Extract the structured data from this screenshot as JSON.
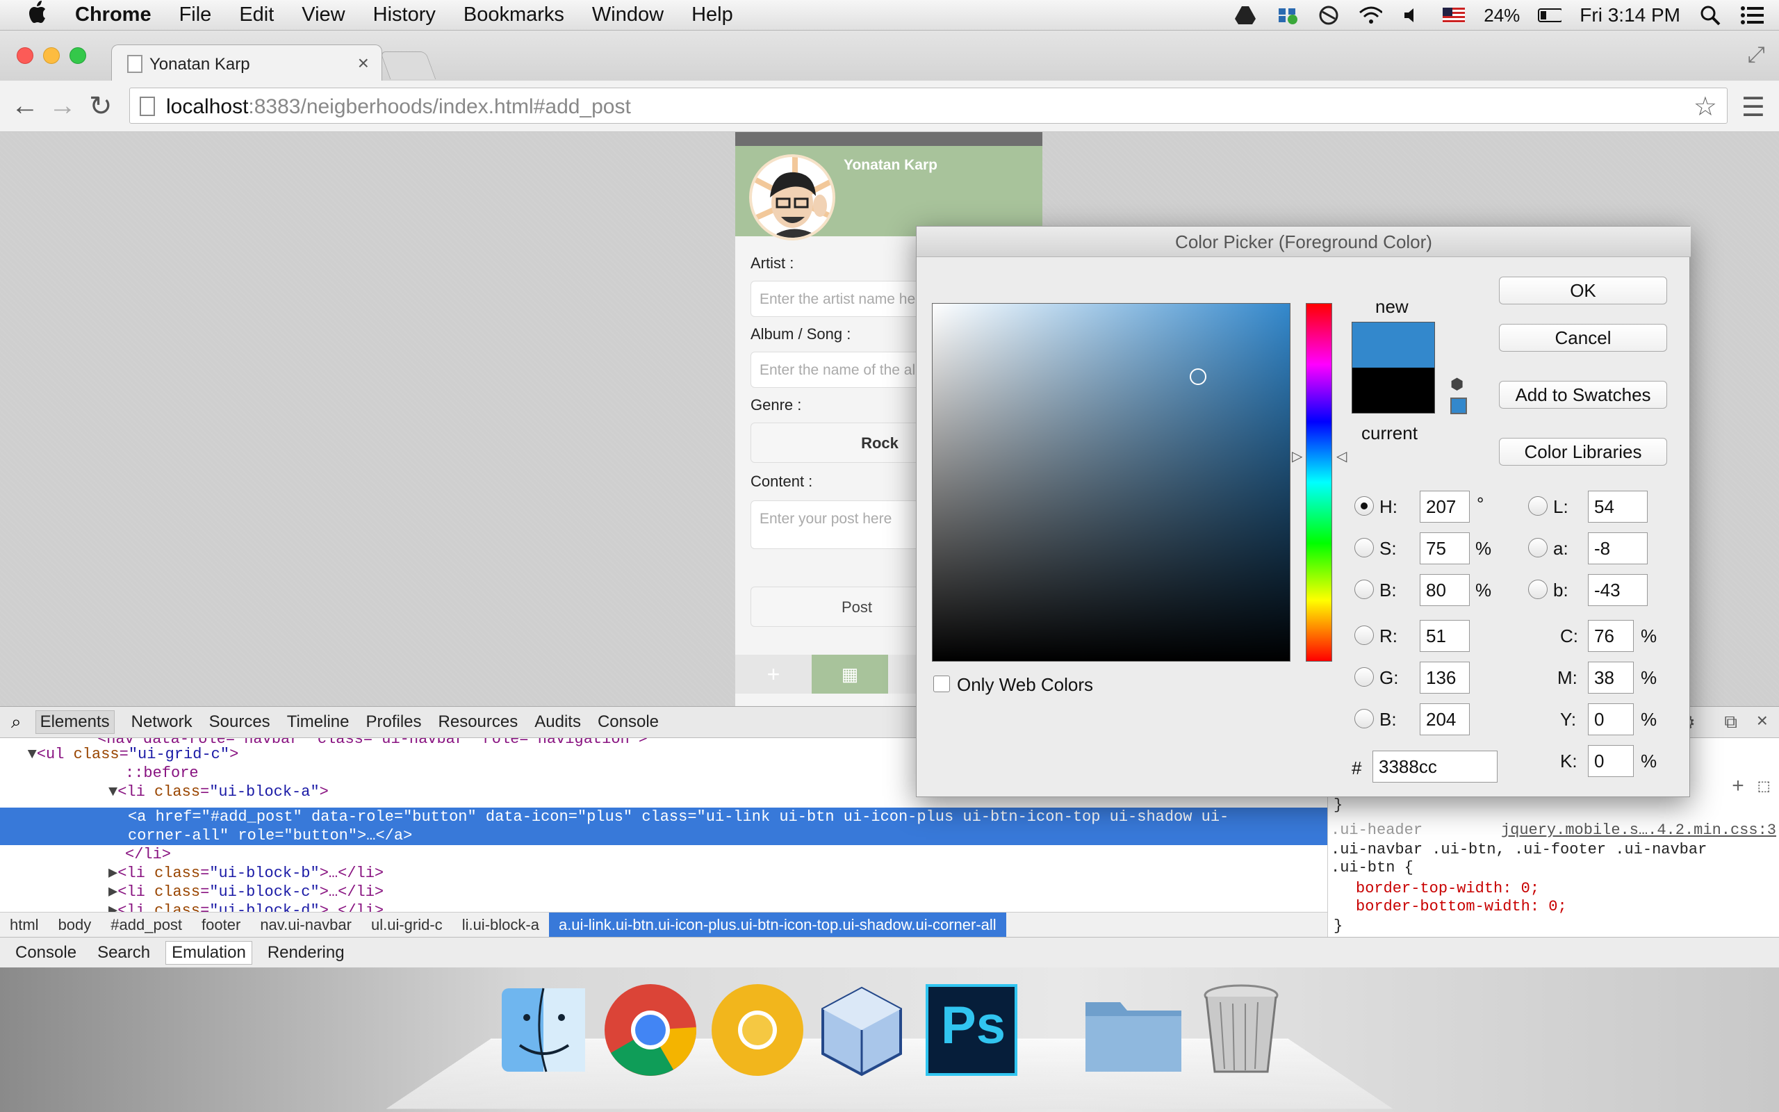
{
  "menubar": {
    "app_name": "Chrome",
    "items": [
      "File",
      "Edit",
      "View",
      "History",
      "Bookmarks",
      "Window",
      "Help"
    ],
    "battery": "24%",
    "clock": "Fri 3:14 PM"
  },
  "browser": {
    "tab_title": "Yonatan Karp",
    "url_host": "localhost",
    "url_rest": ":8383/neigberhoods/index.html#add_post"
  },
  "page": {
    "user_name": "Yonatan Karp",
    "artist_label": "Artist :",
    "artist_placeholder": "Enter the artist name here",
    "album_label": "Album / Song :",
    "album_placeholder": "Enter the name of the album",
    "genre_label": "Genre :",
    "genre_value": "Rock",
    "content_label": "Content :",
    "content_placeholder": "Enter your post here",
    "post_button": "Post"
  },
  "devtools": {
    "tabs": [
      "Elements",
      "Network",
      "Sources",
      "Timeline",
      "Profiles",
      "Resources",
      "Audits",
      "Console"
    ],
    "active_tab": "Elements",
    "breadcrumbs": [
      "html",
      "body",
      "#add_post",
      "footer",
      "nav.ui-navbar",
      "ul.ui-grid-c",
      "li.ui-block-a",
      "a.ui-link.ui-btn.ui-icon-plus.ui-btn-icon-top.ui-shadow.ui-corner-all"
    ],
    "drawer_tabs": [
      "Console",
      "Search",
      "Emulation",
      "Rendering"
    ],
    "drawer_active": "Emulation",
    "code": {
      "l0": "<nav data-role=\"navbar\" class=\"ui-navbar\" role=\"navigation\">",
      "l1_tag": "<ul ",
      "l1_attr": "class",
      "l1_val": "\"ui-grid-c\"",
      "l2": "::before",
      "l3_tag": "<li ",
      "l3_attr": "class",
      "l3_val": "\"ui-block-a\"",
      "sel1": "<a href=\"#add_post\" data-role=\"button\" data-icon=\"plus\" class=\"ui-link ui-btn ui-icon-plus ui-btn-icon-top ui-shadow ui-",
      "sel2": "corner-all\" role=\"button\">…</a>",
      "l5": "</li>",
      "l6_val": "\"ui-block-b\"",
      "l7_val": "\"ui-block-c\"",
      "l8_val": "\"ui-block-d\"",
      "li_close": ">…</li>"
    },
    "styles": {
      "brace": "}",
      "selector1": ".ui-header",
      "source": "jquery.mobile.s….4.2.min.css:3",
      "selector2": ".ui-navbar .ui-btn, .ui-footer .ui-navbar",
      "selector3": ".ui-btn {",
      "prop1": "border-top-width: 0;",
      "prop2": "border-bottom-width: 0;",
      "close": "}"
    }
  },
  "color_picker": {
    "title": "Color Picker (Foreground Color)",
    "new_label": "new",
    "current_label": "current",
    "ok": "OK",
    "cancel": "Cancel",
    "add_swatches": "Add to Swatches",
    "color_libraries": "Color Libraries",
    "only_web_colors": "Only Web Colors",
    "new_color": "#3388cc",
    "current_color": "#000000",
    "hsb": {
      "H": "207",
      "S": "75",
      "B": "80"
    },
    "rgb": {
      "R": "51",
      "G": "136",
      "B": "204"
    },
    "lab": {
      "L": "54",
      "a": "-8",
      "b": "-43"
    },
    "cmyk": {
      "C": "76",
      "M": "38",
      "Y": "0",
      "K": "0"
    },
    "hex": "3388cc",
    "labels": {
      "H": "H:",
      "S": "S:",
      "B": "B:",
      "R": "R:",
      "G": "G:",
      "B2": "B:",
      "L": "L:",
      "a": "a:",
      "b": "b:",
      "C": "C:",
      "M": "M:",
      "Y": "Y:",
      "K": "K:",
      "hash": "#"
    },
    "units": {
      "deg": "°",
      "pct": "%"
    }
  },
  "dock": {
    "apps": [
      "finder-icon",
      "chrome-icon",
      "chrome-canary-icon",
      "virtualbox-icon",
      "photoshop-icon",
      "folder-icon",
      "trash-icon"
    ],
    "photoshop_label": "Ps"
  }
}
